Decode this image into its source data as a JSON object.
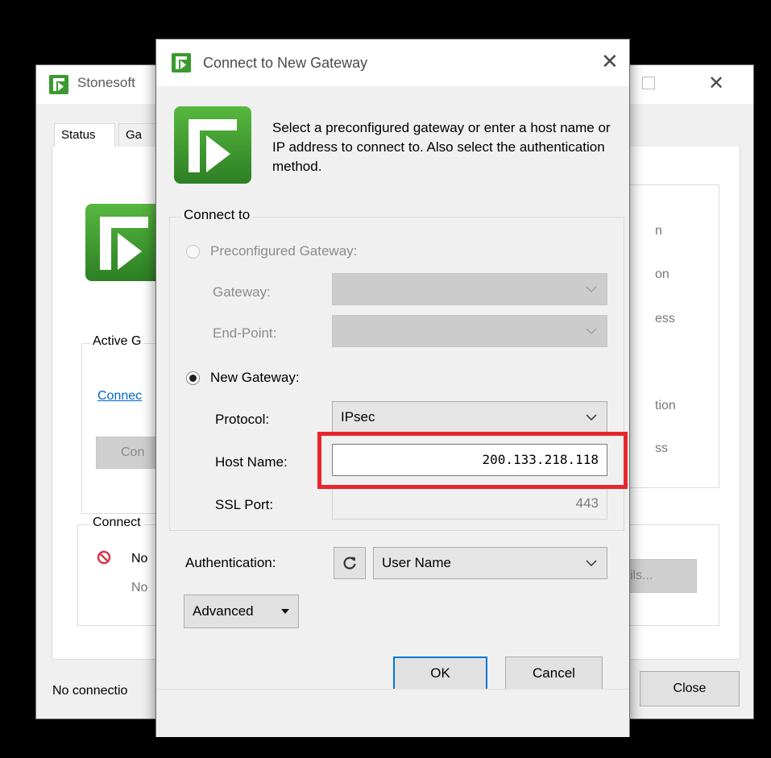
{
  "background_window": {
    "title": "Stonesoft",
    "tabs": [
      "Status",
      "Ga"
    ],
    "active_group_label": "Active G",
    "connect_link": "Connec",
    "connect_button": "Con",
    "connection_group_label": "Connect",
    "status_line1": "No",
    "status_line2": "No",
    "right_column_fragments": [
      "n",
      "on",
      "ess",
      "tion",
      "ss"
    ],
    "details_button": "ils...",
    "footer_status": "No connectio",
    "close_button": "Close"
  },
  "dialog": {
    "title": "Connect to New Gateway",
    "intro_text": "Select a preconfigured gateway or enter a host name or IP address to connect to. Also select the authentication method.",
    "group_label": "Connect to",
    "preconfigured": {
      "label": "Preconfigured Gateway:",
      "gateway_label": "Gateway:",
      "endpoint_label": "End-Point:",
      "gateway_value": "",
      "endpoint_value": ""
    },
    "new_gateway": {
      "label": "New Gateway:",
      "protocol_label": "Protocol:",
      "protocol_value": "IPsec",
      "host_label": "Host Name:",
      "host_value": "200.133.218.118",
      "ssl_port_label": "SSL Port:",
      "ssl_port_value": "443"
    },
    "authentication_label": "Authentication:",
    "authentication_value": "User Name",
    "advanced_button": "Advanced",
    "ok_button": "OK",
    "cancel_button": "Cancel"
  },
  "colors": {
    "logo_green": "#3a9a2f",
    "highlight_red": "#e8252d",
    "default_button_blue": "#0078d7",
    "link_blue": "#0066cc"
  },
  "icons": [
    "stonesoft-logo-icon",
    "close-icon",
    "maximize-icon",
    "chevron-down-icon",
    "refresh-icon",
    "disconnected-icon"
  ]
}
